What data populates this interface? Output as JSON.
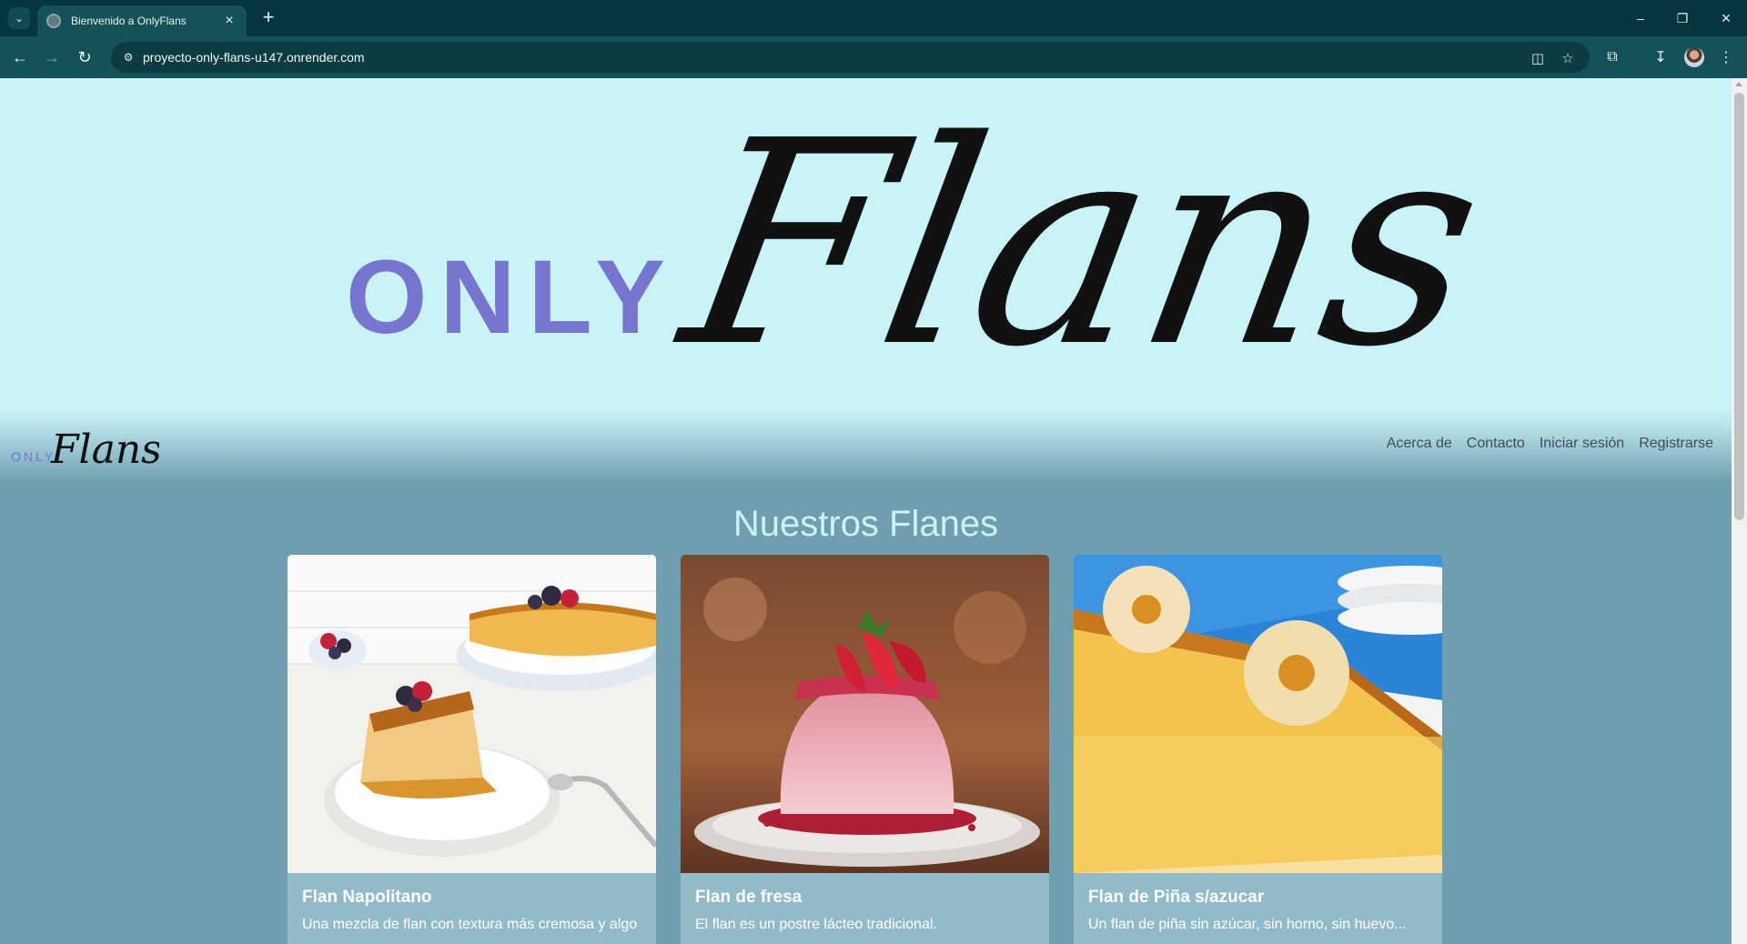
{
  "browser": {
    "tab_title": "Bienvenido a OnlyFlans",
    "url": "proyecto-only-flans-u147.onrender.com"
  },
  "hero": {
    "logo_only": "ONLY",
    "logo_flans": "Flans"
  },
  "navbar": {
    "brand_only": "ONLY",
    "brand_flans": "Flans",
    "links": [
      "Acerca de",
      "Contacto",
      "Iniciar sesión",
      "Registrarse"
    ]
  },
  "main": {
    "section_title": "Nuestros Flanes",
    "cards": [
      {
        "title": "Flan Napolitano",
        "description": "Una mezcla de flan con textura más cremosa y algo"
      },
      {
        "title": "Flan de fresa",
        "description": "El flan es un postre lácteo tradicional."
      },
      {
        "title": "Flan de Piña s/azucar",
        "description": "Un flan de piña sin azúcar, sin horno, sin huevo..."
      }
    ]
  },
  "colors": {
    "hero_bg": "#c8f4f8",
    "page_bg": "#6f9fae",
    "logo_only": "#7676d1",
    "card_bg": "#91bcc7",
    "title_color": "#c8f4f8"
  },
  "icons": [
    "tab-search-icon",
    "globe-icon",
    "close-icon",
    "plus-icon",
    "back-icon",
    "forward-icon",
    "reload-icon",
    "site-info-icon",
    "translate-icon",
    "star-icon",
    "extensions-icon",
    "download-icon",
    "kebab-menu-icon"
  ]
}
